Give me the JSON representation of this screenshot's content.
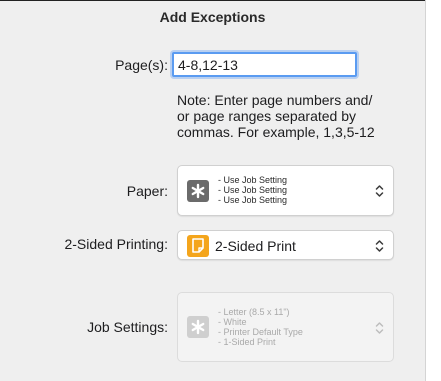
{
  "dialog": {
    "title": "Add Exceptions"
  },
  "pages": {
    "label": "Page(s):",
    "value": "4-8,12-13",
    "note_lines": [
      "Note: Enter page numbers and/",
      "or page ranges separated by",
      "commas.  For example, 1,3,5-12"
    ]
  },
  "paper": {
    "label": "Paper:",
    "icon": "asterisk-icon",
    "lines": [
      "- Use Job Setting",
      "- Use Job Setting",
      "- Use Job Setting"
    ]
  },
  "two_sided": {
    "label": "2-Sided Printing:",
    "icon": "document-icon",
    "icon_color": "#f4a51c",
    "value": "2-Sided Print"
  },
  "job_settings": {
    "label": "Job Settings:",
    "icon": "asterisk-icon",
    "lines": [
      "- Letter (8.5 x 11\")",
      "- White",
      "- Printer Default Type",
      "- 1-Sided Print"
    ]
  },
  "colors": {
    "focus_ring": "#5a9bf1",
    "panel_bg": "#efefef"
  }
}
